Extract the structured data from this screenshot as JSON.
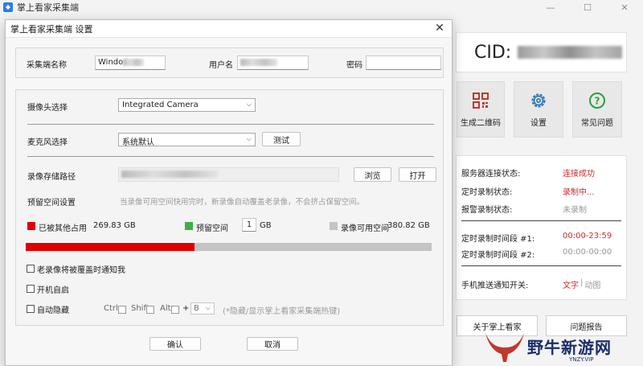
{
  "main_window": {
    "title": "掌上看家采集端",
    "cid_label": "CID:",
    "tiles": [
      {
        "label": "生成二维码",
        "icon": "qr-code-icon"
      },
      {
        "label": "设置",
        "icon": "gear-icon"
      },
      {
        "label": "常见问题",
        "icon": "question-icon"
      }
    ],
    "status": {
      "server_label": "服务器连接状态:",
      "server_value": "连接成功",
      "scheduled_label": "定时录制状态:",
      "scheduled_value": "录制中...",
      "alarm_label": "报警录制状态:",
      "alarm_value": "未录制",
      "period1_label": "定时录制时间段 #1:",
      "period1_value": "00:00-23:59",
      "period2_label": "定时录制时间段 #2:",
      "period2_value": "00:00-00:00",
      "push_label": "手机推送通知开关:",
      "push_text": "文字",
      "push_sep": "|",
      "push_anim": "动图"
    },
    "bottom_buttons": [
      "关于掌上看家",
      "问题报告"
    ]
  },
  "watermark": {
    "text": "野牛新游网",
    "sub": "YNZY.VIP"
  },
  "dialog": {
    "title": "掌上看家采集端 设置",
    "device_name_label": "采集端名称",
    "device_name_value": "Windo",
    "username_label": "用户名",
    "password_label": "密码",
    "camera_label": "摄像头选择",
    "camera_value": "Integrated Camera",
    "mic_label": "麦克风选择",
    "mic_value": "系统默认",
    "test_button": "测试",
    "storage_label": "录像存储路径",
    "browse_button": "浏览",
    "open_button": "打开",
    "reserve_label": "预留空间设置",
    "reserve_hint": "当录像可用空间快用完时，新录像自动覆盖老录像，不会挤占保留空间。",
    "used_other_label": "已被其他占用",
    "used_other_value": "269.83 GB",
    "reserved_label": "预留空间",
    "reserved_value": "1",
    "reserved_unit": "GB",
    "available_label": "录像可用空间",
    "available_value": "380.82 GB",
    "used_fraction": 0.415,
    "notify_overwrite_label": "老录像将被覆盖时通知我",
    "autostart_label": "开机自启",
    "autohide_label": "自动隐藏",
    "hotkey_ctrl": "Ctrl",
    "hotkey_shift": "Shift",
    "hotkey_alt": "Alt",
    "hotkey_plus": "+",
    "hotkey_key": "B",
    "hotkey_hint": "(*隐藏/显示掌上看家采集端热键)",
    "ok_button": "确认",
    "cancel_button": "取消"
  },
  "colors": {
    "used_other": "#e00000",
    "reserved": "#3cb043",
    "available": "#c4c4c4",
    "status_red": "#d12a2a"
  }
}
